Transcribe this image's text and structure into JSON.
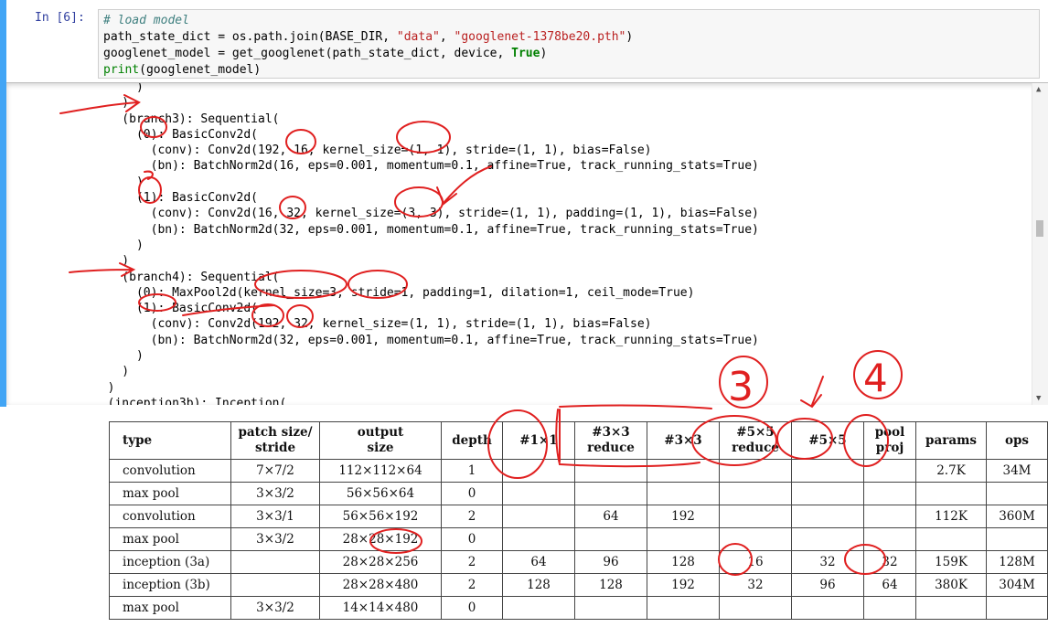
{
  "notebook": {
    "prompt": "In  [6]:",
    "code": {
      "line1_comment": "# load model",
      "line2_a": "path_state_dict = os.path.join(BASE_DIR, ",
      "line2_s1": "\"data\"",
      "line2_b": ", ",
      "line2_s2": "\"googlenet-1378be20.pth\"",
      "line2_c": ")",
      "line3_a": "googlenet_model = get_googlenet(path_state_dict, device, ",
      "line3_kw": "True",
      "line3_c": ")",
      "line4_builtin": "print",
      "line4_rest": "(googlenet_model)"
    },
    "output_lines": [
      "      )",
      "    )",
      "    (branch3): Sequential(",
      "      (0): BasicConv2d(",
      "        (conv): Conv2d(192, 16, kernel_size=(1, 1), stride=(1, 1), bias=False)",
      "        (bn): BatchNorm2d(16, eps=0.001, momentum=0.1, affine=True, track_running_stats=True)",
      "      )",
      "      (1): BasicConv2d(",
      "        (conv): Conv2d(16, 32, kernel_size=(3, 3), stride=(1, 1), padding=(1, 1), bias=False)",
      "        (bn): BatchNorm2d(32, eps=0.001, momentum=0.1, affine=True, track_running_stats=True)",
      "      )",
      "    )",
      "    (branch4): Sequential(",
      "      (0): MaxPool2d(kernel_size=3, stride=1, padding=1, dilation=1, ceil_mode=True)",
      "      (1): BasicConv2d(",
      "        (conv): Conv2d(192, 32, kernel_size=(1, 1), stride=(1, 1), bias=False)",
      "        (bn): BatchNorm2d(32, eps=0.001, momentum=0.1, affine=True, track_running_stats=True)",
      "      )",
      "    )",
      "  )",
      "  (inception3b): Inception("
    ],
    "scroll_up_icon": "▲",
    "scroll_down_icon": "▼"
  },
  "annotations": {
    "mark_3": "3",
    "mark_4": "4",
    "pen_color": "#e02020"
  },
  "table": {
    "headers": [
      "type",
      "patch size/\nstride",
      "output\nsize",
      "depth",
      "#1×1",
      "#3×3\nreduce",
      "#3×3",
      "#5×5\nreduce",
      "#5×5",
      "pool\nproj",
      "params",
      "ops"
    ],
    "rows": [
      [
        "convolution",
        "7×7/2",
        "112×112×64",
        "1",
        "",
        "",
        "",
        "",
        "",
        "",
        "2.7K",
        "34M"
      ],
      [
        "max pool",
        "3×3/2",
        "56×56×64",
        "0",
        "",
        "",
        "",
        "",
        "",
        "",
        "",
        ""
      ],
      [
        "convolution",
        "3×3/1",
        "56×56×192",
        "2",
        "",
        "64",
        "192",
        "",
        "",
        "",
        "112K",
        "360M"
      ],
      [
        "max pool",
        "3×3/2",
        "28×28×192",
        "0",
        "",
        "",
        "",
        "",
        "",
        "",
        "",
        ""
      ],
      [
        "inception (3a)",
        "",
        "28×28×256",
        "2",
        "64",
        "96",
        "128",
        "16",
        "32",
        "32",
        "159K",
        "128M"
      ],
      [
        "inception (3b)",
        "",
        "28×28×480",
        "2",
        "128",
        "128",
        "192",
        "32",
        "96",
        "64",
        "380K",
        "304M"
      ],
      [
        "max pool",
        "3×3/2",
        "14×14×480",
        "0",
        "",
        "",
        "",
        "",
        "",
        "",
        "",
        ""
      ]
    ]
  }
}
